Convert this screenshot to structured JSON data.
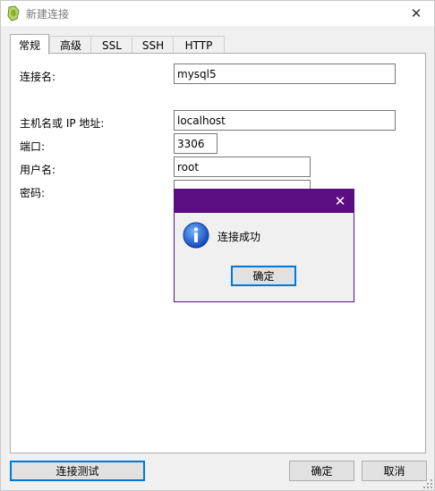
{
  "window": {
    "title": "新建连接",
    "close_glyph": "✕"
  },
  "tabs": [
    {
      "label": "常规",
      "active": true
    },
    {
      "label": "高级",
      "active": false
    },
    {
      "label": "SSL",
      "active": false
    },
    {
      "label": "SSH",
      "active": false
    },
    {
      "label": "HTTP",
      "active": false
    }
  ],
  "form": {
    "connection_name_label": "连接名:",
    "connection_name_value": "mysql5",
    "host_label": "主机名或 IP 地址:",
    "host_value": "localhost",
    "port_label": "端口:",
    "port_value": "3306",
    "user_label": "用户名:",
    "user_value": "root",
    "password_label": "密码:"
  },
  "buttons": {
    "test_connection": "连接测试",
    "ok": "确定",
    "cancel": "取消"
  },
  "message_box": {
    "close_glyph": "✕",
    "text": "连接成功",
    "ok": "确定",
    "icon": "info-icon",
    "title_color": "#5a0e82"
  },
  "colors": {
    "accent": "#0078d7",
    "dialog_title": "#5a0e82"
  }
}
